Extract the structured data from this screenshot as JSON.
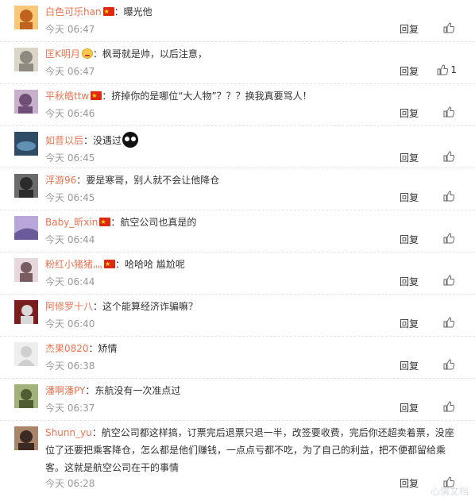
{
  "comments": [
    {
      "id": "c1",
      "user": "白色可乐han",
      "badge": "flag",
      "text": "：曝光他",
      "time": "今天 06:47",
      "reply": "回复",
      "likes": "",
      "avatar": {
        "bg": "#f7c77a",
        "fg": "#c0631e"
      }
    },
    {
      "id": "c2",
      "user": "匡K明月",
      "badge": "emoji",
      "text": "：枫哥就是帅，以后注意，",
      "time": "今天 06:47",
      "reply": "回复",
      "likes": "1",
      "avatar": {
        "bg": "#dcd6c8",
        "fg": "#8e8a80"
      }
    },
    {
      "id": "c3",
      "user": "平秋皓ttw",
      "badge": "flag",
      "text": "：挤掉你的是哪位“大人物”？？？换我真要骂人！",
      "time": "今天 06:46",
      "reply": "回复",
      "likes": "",
      "avatar": {
        "bg": "#c7b0c9",
        "fg": "#6f4f76"
      }
    },
    {
      "id": "c4",
      "user": "如昔以后",
      "badge": "",
      "text": "：没遇过",
      "emoji_after": "ball",
      "time": "今天 06:45",
      "reply": "回复",
      "likes": "",
      "avatar": {
        "bg": "#2f4b66",
        "fg": "#5f8fb3"
      }
    },
    {
      "id": "c5",
      "user": "浮游96",
      "badge": "",
      "text": "：要是寒哥，别人就不会让他降仓",
      "time": "今天 06:45",
      "reply": "回复",
      "likes": "",
      "avatar": {
        "bg": "#6b6b6b",
        "fg": "#2c2c2c"
      }
    },
    {
      "id": "c6",
      "user": "Baby_昕xin",
      "badge": "flag",
      "text": "：航空公司也真是的",
      "time": "今天 06:44",
      "reply": "回复",
      "likes": "",
      "avatar": {
        "bg": "#b8a7d8",
        "fg": "#6a5a9a"
      }
    },
    {
      "id": "c7",
      "user": "粉红小猪猪灬",
      "badge": "flag",
      "text": "：哈哈哈 尴尬呢",
      "time": "今天 06:44",
      "reply": "回复",
      "likes": "",
      "avatar": {
        "bg": "#e6d8dc",
        "fg": "#7a5c63"
      }
    },
    {
      "id": "c8",
      "user": "阿修罗十八",
      "badge": "",
      "text": "：这个能算经济诈骗嘛？",
      "time": "今天 06:40",
      "reply": "回复",
      "likes": "",
      "avatar": {
        "bg": "#7a1f1f",
        "fg": "#d9d9d9"
      }
    },
    {
      "id": "c9",
      "user": "杰果0820",
      "badge": "",
      "text": "：矫情",
      "time": "今天 06:38",
      "reply": "回复",
      "likes": "",
      "avatar": {
        "bg": "#eeeeee",
        "fg": "#cfcfcf"
      }
    },
    {
      "id": "c10",
      "user": "潘啊潘PY",
      "badge": "",
      "text": "：东航没有一次准点过",
      "time": "今天 06:37",
      "reply": "回复",
      "likes": "",
      "avatar": {
        "bg": "#a3b27a",
        "fg": "#4f5d33"
      }
    },
    {
      "id": "c11",
      "user": "Shunn_yu",
      "badge": "",
      "text": "：航空公司都这样搞，订票完后退票只退一半，改签要收费，完后你还超卖着票，没座位了还要把乘客降仓，怎么都是他们赚钱，一点点亏都不吃，为了自己的利益，把不便都留给乘客。这就是航空公司在干的事情",
      "time": "今天 06:28",
      "reply": "回复",
      "likes": "",
      "avatar": {
        "bg": "#a9866b",
        "fg": "#3b2a22"
      }
    }
  ],
  "watermark": "心情文档"
}
